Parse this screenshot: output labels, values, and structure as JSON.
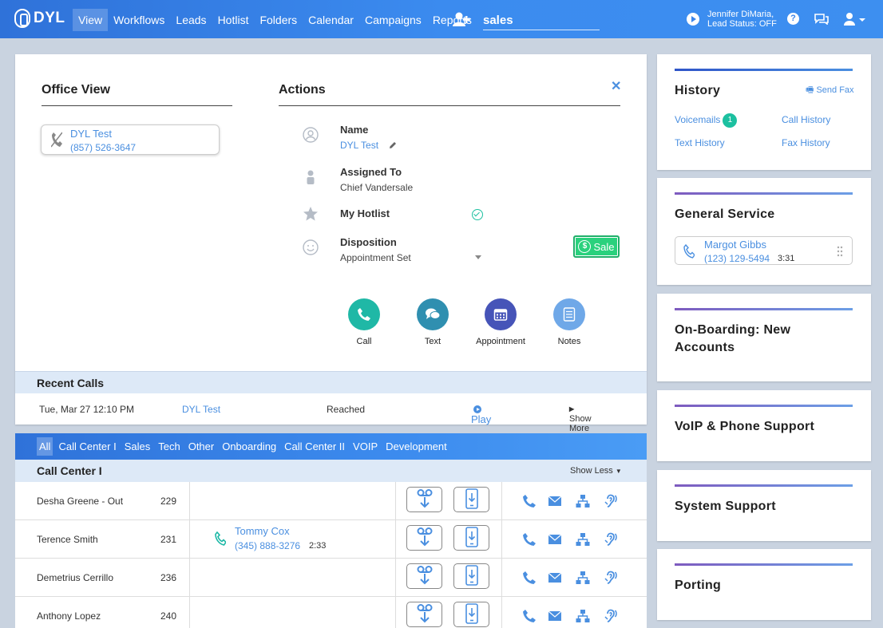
{
  "app": {
    "logo_text": "DYL"
  },
  "nav": [
    "View",
    "Workflows",
    "Leads",
    "Hotlist",
    "Folders",
    "Calendar",
    "Campaigns",
    "Reports"
  ],
  "search": {
    "value": "sales"
  },
  "user": {
    "name": "Jennifer DiMaria,",
    "status": "Lead Status: OFF"
  },
  "office": {
    "title": "Office View",
    "contact_name": "DYL Test",
    "contact_phone": "(857) 526-3647"
  },
  "actions": {
    "title": "Actions",
    "name_label": "Name",
    "name_value": "DYL Test",
    "assigned_label": "Assigned To",
    "assigned_value": "Chief Vandersale",
    "hotlist_label": "My Hotlist",
    "disposition_label": "Disposition",
    "disposition_value": "Appointment Set",
    "sale_label": "Sale",
    "buttons": [
      {
        "label": "Call",
        "color": "#1fb8a6"
      },
      {
        "label": "Text",
        "color": "#2f8fb0"
      },
      {
        "label": "Appointment",
        "color": "#4654b8"
      },
      {
        "label": "Notes",
        "color": "#6fa8e8"
      }
    ]
  },
  "recent_calls": {
    "title": "Recent Calls",
    "row": {
      "date": "Tue, Mar 27 12:10 PM",
      "name": "DYL Test",
      "status": "Reached",
      "play": "Play"
    },
    "show_more": "Show More"
  },
  "tabs": [
    "All",
    "Call Center I",
    "Sales",
    "Tech",
    "Other",
    "Onboarding",
    "Call Center II",
    "VOIP",
    "Development"
  ],
  "call_center": {
    "title": "Call Center I",
    "show_less": "Show Less",
    "agents": [
      {
        "name": "Desha Greene - Out",
        "ext": "229"
      },
      {
        "name": "Terence Smith",
        "ext": "231",
        "call_name": "Tommy Cox",
        "call_phone": "(345) 888-3276",
        "call_time": "2:33"
      },
      {
        "name": "Demetrius Cerrillo",
        "ext": "236"
      },
      {
        "name": "Anthony Lopez",
        "ext": "240"
      }
    ]
  },
  "history": {
    "title": "History",
    "send_fax": "Send Fax",
    "voicemails": "Voicemails",
    "voicemail_count": "1",
    "call_history": "Call History",
    "text_history": "Text History",
    "fax_history": "Fax History"
  },
  "general_service": {
    "title": "General Service",
    "name": "Margot Gibbs",
    "phone": "(123) 129-5494",
    "time": "3:31"
  },
  "groups": {
    "onboarding_line1": "On-Boarding: New",
    "onboarding_line2": "Accounts",
    "voip": "VoIP & Phone Support",
    "system": "System Support",
    "porting": "Porting"
  },
  "colors": {
    "accent": "#3b85ea",
    "link": "#4a8fe0",
    "teal": "#1cc0a0",
    "sale": "#2ad17d"
  }
}
